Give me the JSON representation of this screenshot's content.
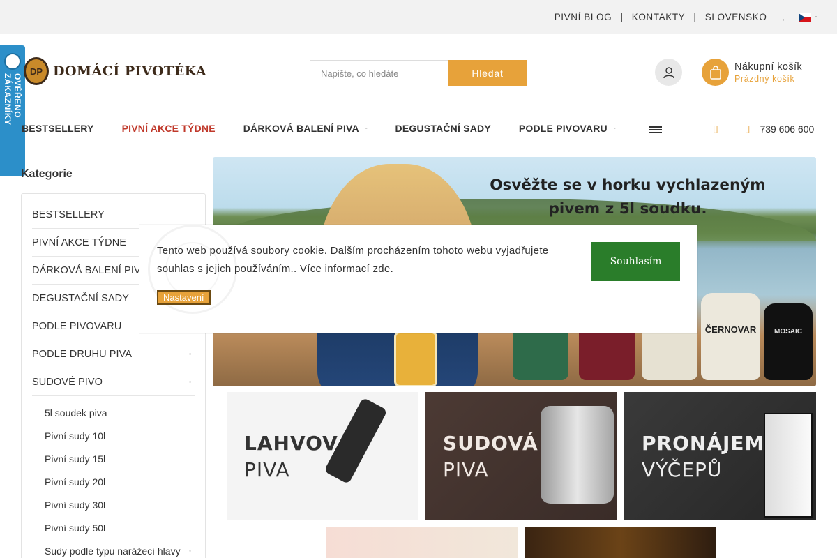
{
  "topbar": {
    "links": [
      "PIVNÍ BLOG",
      "KONTAKTY",
      "SLOVENSKO"
    ],
    "separator": "|",
    "language": "Czech"
  },
  "logo": {
    "mark": "DP",
    "text": "DOMÁCÍ PIVOTÉKA"
  },
  "search": {
    "placeholder": "Napište, co hledáte",
    "button": "Hledat"
  },
  "cart": {
    "title": "Nákupní košík",
    "status": "Prázdný košík"
  },
  "nav": {
    "items": [
      {
        "label": "BESTSELLERY",
        "dropdown": false
      },
      {
        "label": "PIVNÍ AKCE TÝDNE",
        "dropdown": false,
        "highlight": true
      },
      {
        "label": "DÁRKOVÁ BALENÍ PIVA",
        "dropdown": true
      },
      {
        "label": "DEGUSTAČNÍ SADY",
        "dropdown": false
      },
      {
        "label": "PODLE PIVOVARU",
        "dropdown": true
      }
    ],
    "phone": "739 606 600"
  },
  "badge": {
    "text": "OVĚŘENO ZÁKAZNÍKY"
  },
  "sidebar": {
    "title": "Kategorie",
    "items": [
      {
        "label": "BESTSELLERY",
        "arrow": false
      },
      {
        "label": "PIVNÍ AKCE TÝDNE",
        "arrow": false
      },
      {
        "label": "DÁRKOVÁ BALENÍ PIVA",
        "arrow": true
      },
      {
        "label": "DEGUSTAČNÍ SADY",
        "arrow": false
      },
      {
        "label": "PODLE PIVOVARU",
        "arrow": true
      },
      {
        "label": "PODLE DRUHU PIVA",
        "arrow": true
      },
      {
        "label": "SUDOVÉ PIVO",
        "arrow": true
      }
    ],
    "subitems": [
      {
        "label": "5l soudek piva",
        "arrow": false
      },
      {
        "label": "Pivní sudy 10l",
        "arrow": false
      },
      {
        "label": "Pivní sudy 15l",
        "arrow": false
      },
      {
        "label": "Pivní sudy 20l",
        "arrow": false
      },
      {
        "label": "Pivní sudy 30l",
        "arrow": false
      },
      {
        "label": "Pivní sudy 50l",
        "arrow": false
      },
      {
        "label": "Sudy podle typu narážecí hlavy",
        "arrow": true
      }
    ]
  },
  "banner": {
    "headline_line1": "Osvěžte se v horku vychlazeným",
    "headline_line2": "pivem z 5l soudku.",
    "keg_labels": [
      "ČERNOVAR",
      "MOSAIC"
    ]
  },
  "tiles": [
    {
      "line1": "LAHVOVÁ",
      "line2": "PIVA"
    },
    {
      "line1": "SUDOVÁ",
      "line2": "PIVA"
    },
    {
      "line1": "PRONÁJEM",
      "line2": "VÝČEPŮ"
    }
  ],
  "cookie": {
    "message": "Tento web používá soubory cookie. Dalším procházením tohoto webu vyjadřujete souhlas s jejich používáním.. Více informací ",
    "link": "zde",
    "after_link": ".",
    "settings": "Nastavení",
    "agree": "Souhlasím"
  },
  "colors": {
    "accent": "#e7a23a",
    "promo": "#c0392b",
    "agree": "#2a7d2a",
    "badge": "#2c8fc9"
  }
}
